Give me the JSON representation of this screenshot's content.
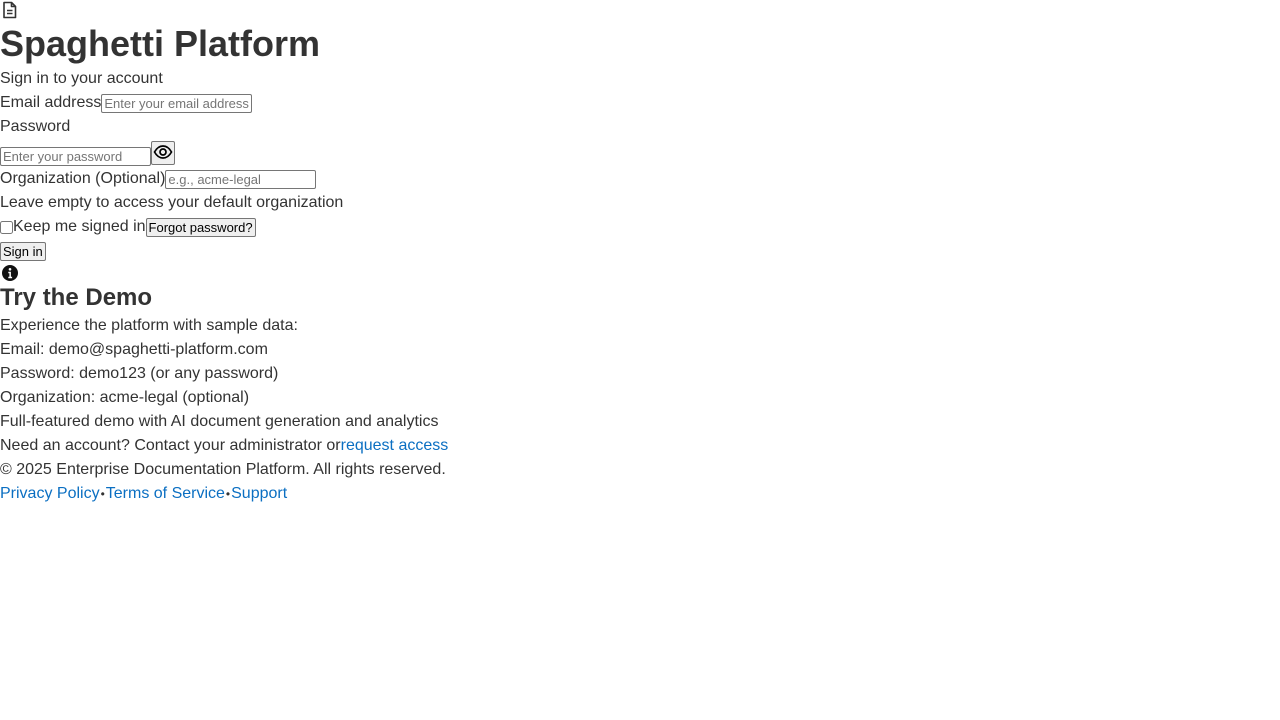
{
  "header": {
    "logo_icon": "document-icon",
    "title": "Spaghetti Platform",
    "subtitle": "Sign in to your account"
  },
  "form": {
    "email_label": "Email address",
    "email_placeholder": "Enter your email address",
    "password_label": "Password",
    "password_placeholder": "Enter your password",
    "toggle_password_icon": "eye-icon",
    "org_label": "Organization (Optional)",
    "org_placeholder": "e.g., acme-legal",
    "org_help": "Leave empty to access your default organization",
    "remember_label": "Keep me signed in",
    "forgot_label": "Forgot password?",
    "submit_label": "Sign in"
  },
  "demo": {
    "icon": "info-icon",
    "title": "Try the Demo",
    "intro": "Experience the platform with sample data:",
    "email": "Email: demo@spaghetti-platform.com",
    "password": "Password: demo123 (or any password)",
    "organization": "Organization: acme-legal (optional)",
    "features": "Full-featured demo with AI document generation and analytics"
  },
  "signup": {
    "text": "Need an account? Contact your administrator or",
    "link_label": "request access"
  },
  "footer": {
    "copyright": "© 2025 Enterprise Documentation Platform. All rights reserved.",
    "links": [
      "Privacy Policy",
      "Terms of Service",
      "Support"
    ],
    "separator": "•"
  },
  "colors": {
    "text": "#333333",
    "link": "#0b6fc2"
  }
}
